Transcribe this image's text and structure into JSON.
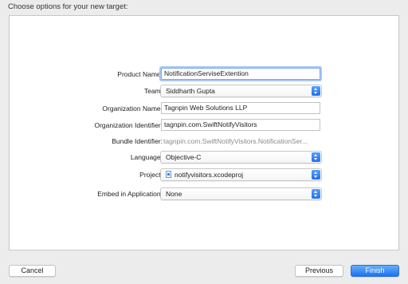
{
  "header": {
    "title": "Choose options for your new target:"
  },
  "form": {
    "product_name": {
      "label": "Product Name:",
      "value": "NotificationServiseExtention"
    },
    "team": {
      "label": "Team:",
      "value": "Siddharth Gupta"
    },
    "organization_name": {
      "label": "Organization Name:",
      "value": "Tagnpin Web Solutions LLP"
    },
    "organization_identifier": {
      "label": "Organization Identifier:",
      "value": "tagnpin.com.SwiftNotifyVisitors"
    },
    "bundle_identifier": {
      "label": "Bundle Identifier:",
      "value": "tagnpin.com.SwiftNotifyVisitors.NotificationSer..."
    },
    "language": {
      "label": "Language:",
      "value": "Objective-C"
    },
    "project": {
      "label": "Project:",
      "value": "notifyvisitors.xcodeproj",
      "icon": "xcodeproj-file-icon"
    },
    "embed_in_application": {
      "label": "Embed in Application:",
      "value": "None"
    }
  },
  "buttons": {
    "cancel": "Cancel",
    "previous": "Previous",
    "finish": "Finish"
  },
  "colors": {
    "accent": "#1b73f0",
    "focus_ring": "#a9c8f3"
  }
}
